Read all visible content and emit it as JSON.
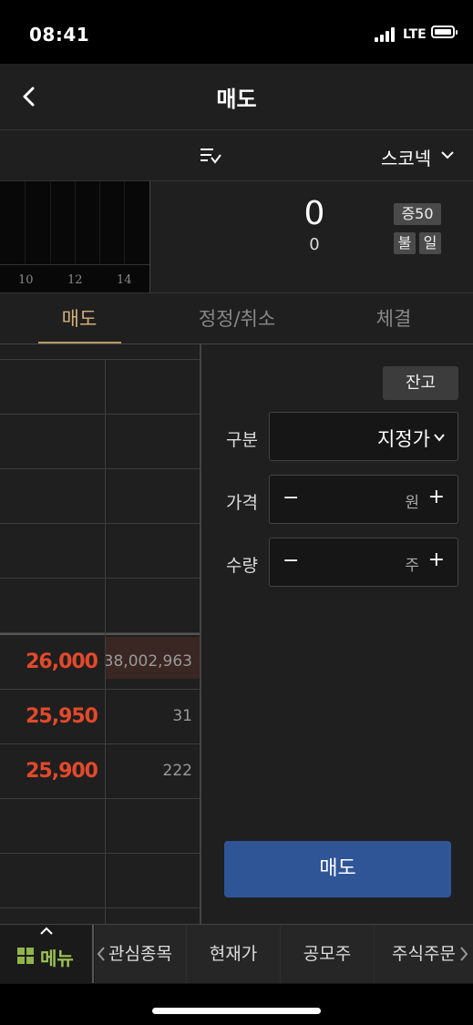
{
  "status_bar": {
    "time": "08:41",
    "network": "LTE"
  },
  "header": {
    "title": "매도",
    "back_icon": "chevron-left-icon"
  },
  "stock": {
    "name": "스코넥",
    "sort_icon": "sort-check-icon"
  },
  "chart": {
    "x_ticks": [
      "10",
      "12",
      "14"
    ]
  },
  "quote": {
    "price": "0",
    "change": "0",
    "badges": [
      "증50",
      "불",
      "일"
    ]
  },
  "tabs": [
    {
      "label": "매도",
      "active": true
    },
    {
      "label": "정정/취소",
      "active": false
    },
    {
      "label": "체결",
      "active": false
    }
  ],
  "order_book": {
    "rows": [
      {
        "price": "",
        "qty": ""
      },
      {
        "price": "",
        "qty": ""
      },
      {
        "price": "",
        "qty": ""
      },
      {
        "price": "",
        "qty": ""
      },
      {
        "price": "",
        "qty": ""
      },
      {
        "price": "26,000",
        "qty": "38,002,963"
      },
      {
        "price": "25,950",
        "qty": "31"
      },
      {
        "price": "25,900",
        "qty": "222"
      },
      {
        "price": "",
        "qty": ""
      },
      {
        "price": "",
        "qty": ""
      }
    ],
    "price_color": "#e2492b"
  },
  "form": {
    "balance_label": "잔고",
    "type_label": "구분",
    "type_value": "지정가",
    "price_label": "가격",
    "price_unit": "원",
    "qty_label": "수량",
    "qty_unit": "주",
    "minus": "−",
    "plus": "+"
  },
  "sell_button": {
    "label": "매도",
    "color": "#2f5597"
  },
  "bottom_nav": {
    "menu_label": "메뉴",
    "items": [
      "관심종목",
      "현재가",
      "공모주",
      "주식주문"
    ],
    "accent": "#9dc256"
  }
}
